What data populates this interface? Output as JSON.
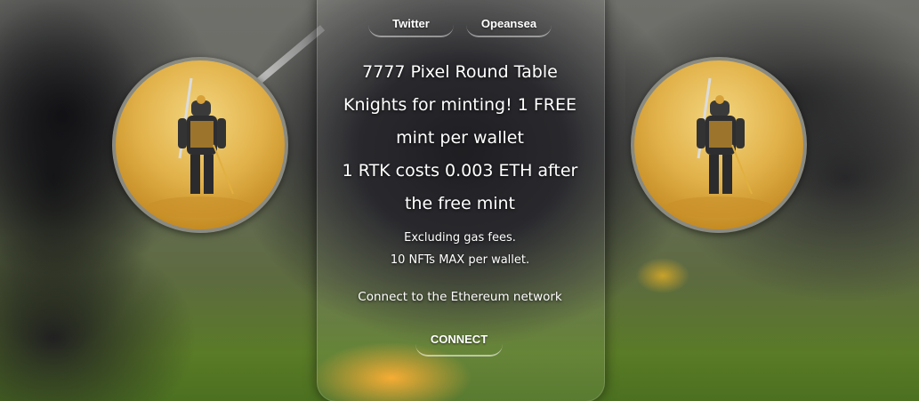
{
  "nav": {
    "twitter_label": "Twitter",
    "opensea_label": "Opeansea"
  },
  "headline": {
    "line1": "7777 Pixel Round Table",
    "line2": "Knights for minting! 1 FREE",
    "line3": "mint per wallet",
    "line4": "1 RTK costs 0.003 ETH after",
    "line5": "the free mint"
  },
  "info": {
    "gas_note": "Excluding gas fees.",
    "max_note": "10 NFTs MAX per wallet.",
    "network_note": "Connect to the Ethereum network"
  },
  "actions": {
    "connect_label": "CONNECT"
  },
  "colors": {
    "avatar_gold": "#e2b24a",
    "avatar_border": "#8a8a80"
  },
  "images": {
    "avatar_left": "knight-nft-image",
    "avatar_right": "knight-nft-image"
  }
}
